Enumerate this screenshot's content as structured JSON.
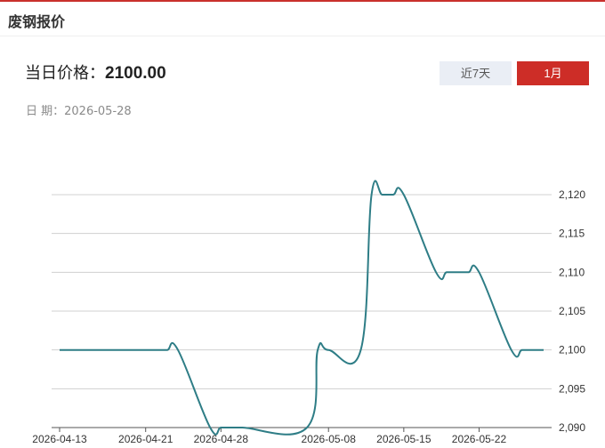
{
  "header": {
    "title": "废钢报价"
  },
  "price": {
    "label": "当日价格：",
    "value": "2100.00"
  },
  "date": {
    "label": "日  期：",
    "value": "2026-05-28"
  },
  "range_buttons": [
    {
      "label": "近7天",
      "active": false
    },
    {
      "label": "1月",
      "active": true
    }
  ],
  "colors": {
    "accent": "#cd2d27",
    "line": "#2e7d86",
    "inactive_button": "#eaeef5"
  },
  "chart_data": {
    "type": "line",
    "title": "",
    "xlabel": "",
    "ylabel": "",
    "x_ticks": [
      "2026-04-13",
      "2026-04-21",
      "2026-04-28",
      "2026-05-08",
      "2026-05-15",
      "2026-05-22"
    ],
    "y_ticks": [
      "2,090",
      "2,095",
      "2,100",
      "2,105",
      "2,110",
      "2,115",
      "2,120"
    ],
    "ylim": [
      2090,
      2120
    ],
    "grid": true,
    "series": [
      {
        "x": [
          "2026-04-13",
          "2026-04-14",
          "2026-04-15",
          "2026-04-16",
          "2026-04-17",
          "2026-04-20",
          "2026-04-21",
          "2026-04-22",
          "2026-04-23",
          "2026-04-24",
          "2026-04-27",
          "2026-04-28",
          "2026-04-29",
          "2026-04-30",
          "2026-05-06",
          "2026-05-07",
          "2026-05-08",
          "2026-05-11",
          "2026-05-12",
          "2026-05-13",
          "2026-05-14",
          "2026-05-15",
          "2026-05-18",
          "2026-05-19",
          "2026-05-20",
          "2026-05-21",
          "2026-05-22",
          "2026-05-25",
          "2026-05-26",
          "2026-05-27",
          "2026-05-28"
        ],
        "values": [
          2100,
          2100,
          2100,
          2100,
          2100,
          2100,
          2100,
          2100,
          2100,
          2100,
          2090,
          2090,
          2090,
          2090,
          2090,
          2100,
          2100,
          2100,
          2120,
          2120,
          2120,
          2120,
          2110,
          2110,
          2110,
          2110,
          2110,
          2100,
          2100,
          2100,
          2100
        ]
      }
    ]
  }
}
